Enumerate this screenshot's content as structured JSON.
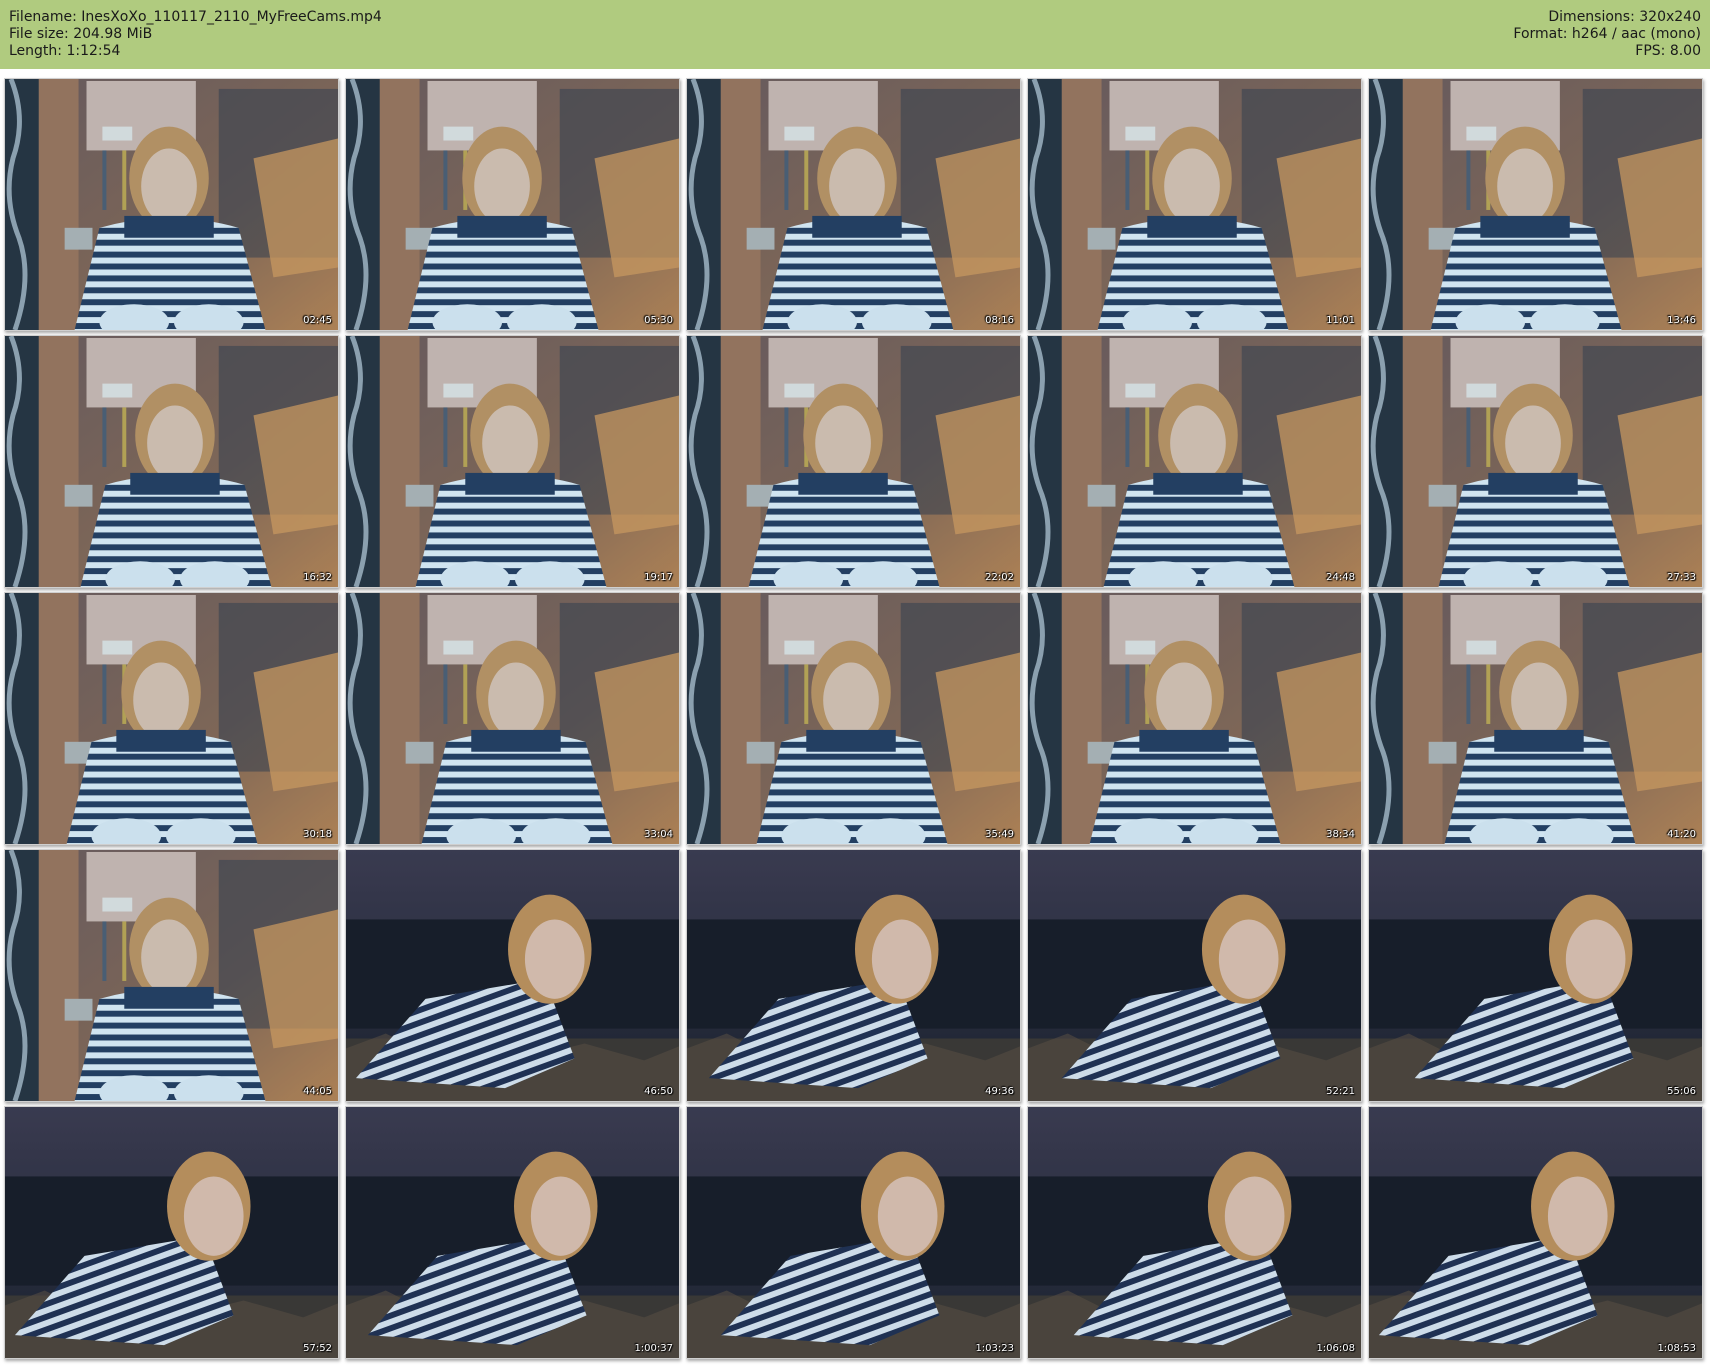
{
  "header": {
    "filename": "Filename: InesXoXo_110117_2110_MyFreeCams.mp4",
    "filesize": "File size: 204.98 MiB",
    "length": "Length: 1:12:54",
    "dimensions": "Dimensions: 320x240",
    "format": "Format: h264 / aac (mono)",
    "fps": "FPS: 8.00",
    "background_color": "#b0cb7f"
  },
  "thumbnails": [
    {
      "time": "02:45",
      "scene": "room"
    },
    {
      "time": "05:30",
      "scene": "room"
    },
    {
      "time": "08:16",
      "scene": "room"
    },
    {
      "time": "11:01",
      "scene": "room"
    },
    {
      "time": "13:46",
      "scene": "room"
    },
    {
      "time": "16:32",
      "scene": "room"
    },
    {
      "time": "19:17",
      "scene": "room"
    },
    {
      "time": "22:02",
      "scene": "room"
    },
    {
      "time": "24:48",
      "scene": "room"
    },
    {
      "time": "27:33",
      "scene": "room"
    },
    {
      "time": "30:18",
      "scene": "room"
    },
    {
      "time": "33:04",
      "scene": "room"
    },
    {
      "time": "35:49",
      "scene": "room"
    },
    {
      "time": "38:34",
      "scene": "room"
    },
    {
      "time": "41:20",
      "scene": "room"
    },
    {
      "time": "44:05",
      "scene": "room"
    },
    {
      "time": "46:50",
      "scene": "dark"
    },
    {
      "time": "49:36",
      "scene": "dark"
    },
    {
      "time": "52:21",
      "scene": "dark"
    },
    {
      "time": "55:06",
      "scene": "dark"
    },
    {
      "time": "57:52",
      "scene": "dark"
    },
    {
      "time": "1:00:37",
      "scene": "dark"
    },
    {
      "time": "1:03:23",
      "scene": "dark"
    },
    {
      "time": "1:06:08",
      "scene": "dark"
    },
    {
      "time": "1:08:53",
      "scene": "dark"
    }
  ]
}
